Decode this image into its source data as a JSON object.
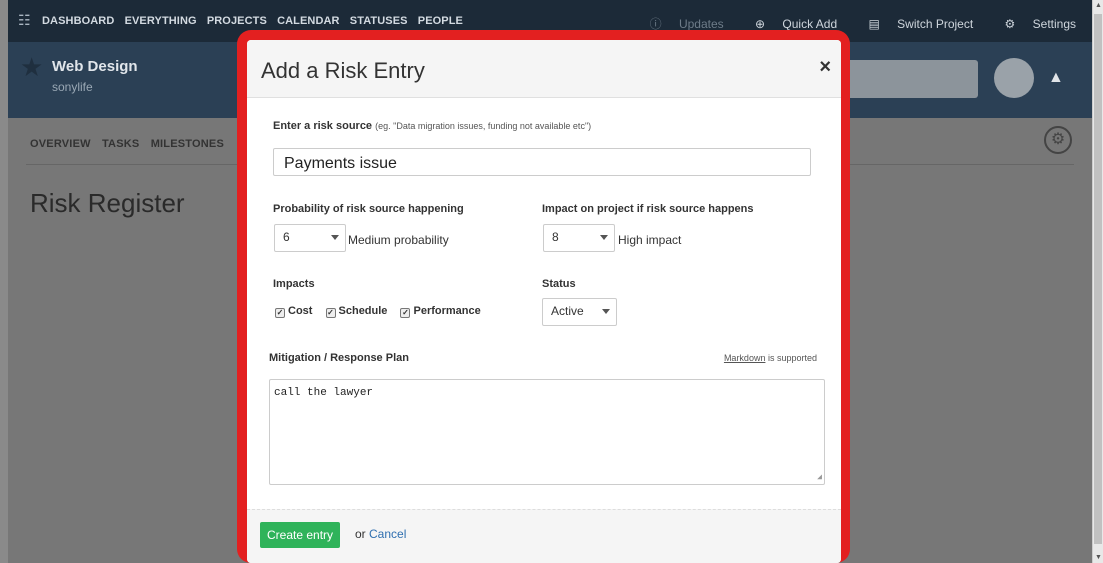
{
  "topbar": {
    "logo_icon": "app-logo-icon",
    "nav": [
      "DASHBOARD",
      "EVERYTHING",
      "PROJECTS",
      "CALENDAR",
      "STATUSES",
      "PEOPLE"
    ],
    "updates": "Updates",
    "quick_add": "Quick Add",
    "switch_project": "Switch Project",
    "settings": "Settings"
  },
  "project": {
    "name": "Web Design",
    "subtitle": "sonylife"
  },
  "subnav": [
    "OVERVIEW",
    "TASKS",
    "MILESTONES"
  ],
  "page": {
    "title": "Risk Register"
  },
  "modal": {
    "title": "Add a Risk Entry",
    "close": "×",
    "source_label": "Enter a risk source",
    "source_hint": "(eg. \"Data migration issues, funding not available etc\")",
    "source_value": "Payments issue",
    "probability_label": "Probability of risk source happening",
    "probability_value": "6",
    "probability_text": "Medium probability",
    "impact_label": "Impact on project if risk source happens",
    "impact_value": "8",
    "impact_text": "High impact",
    "impacts_label": "Impacts",
    "impacts": [
      {
        "label": "Cost",
        "checked": true
      },
      {
        "label": "Schedule",
        "checked": true
      },
      {
        "label": "Performance",
        "checked": true
      }
    ],
    "status_label": "Status",
    "status_value": "Active",
    "mitigation_label": "Mitigation / Response Plan",
    "markdown_link": "Markdown",
    "markdown_suffix": "is supported",
    "mitigation_value": "call the lawyer",
    "create_button": "Create entry",
    "or_text": "or",
    "cancel_link": "Cancel"
  },
  "colors": {
    "highlight_frame": "#e32020",
    "create_button": "#2fb35a",
    "link": "#2f6fb0",
    "topbar": "#1c2a38",
    "projectbar": "#2b4055"
  }
}
